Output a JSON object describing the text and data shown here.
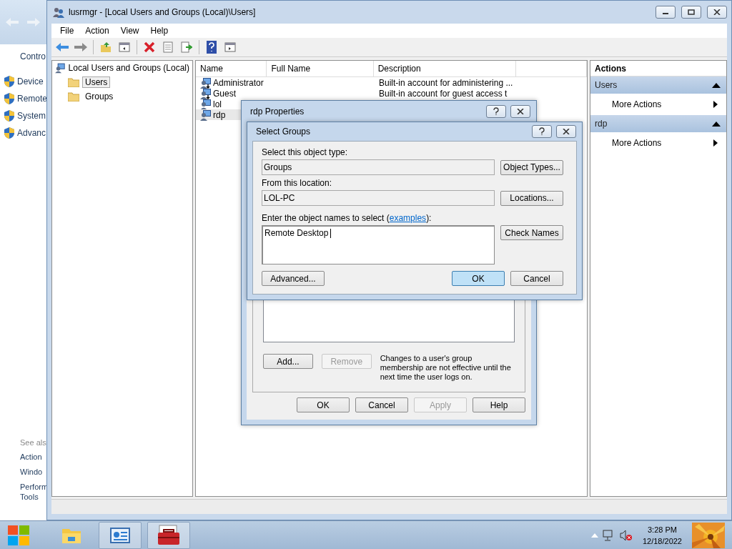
{
  "control_panel": {
    "header": "Contro",
    "items": [
      "Device",
      "Remote",
      "System",
      "Advanc"
    ],
    "see_also": {
      "heading": "See als",
      "items": [
        "Action",
        "Windo",
        "Perform Tools"
      ]
    }
  },
  "main_window": {
    "title": "lusrmgr - [Local Users and Groups (Local)\\Users]",
    "menu": [
      "File",
      "Action",
      "View",
      "Help"
    ],
    "tree": {
      "label": "Local Users and Groups (Local)",
      "children": [
        {
          "label": "Users",
          "selected": true
        },
        {
          "label": "Groups",
          "selected": false
        }
      ]
    },
    "list": {
      "columns": [
        "Name",
        "Full Name",
        "Description"
      ],
      "rows": [
        {
          "name": "Administrator",
          "kind": "builtin",
          "description": "Built-in account for administering ...",
          "selected": false
        },
        {
          "name": "Guest",
          "kind": "builtin",
          "description": "Built-in account for guest access t",
          "selected": false
        },
        {
          "name": "lol",
          "kind": "user",
          "selected": false
        },
        {
          "name": "rdp",
          "kind": "user",
          "selected": true
        }
      ]
    },
    "actions": {
      "title": "Actions",
      "sections": [
        {
          "label": "Users",
          "items": [
            "More Actions"
          ]
        },
        {
          "label": "rdp",
          "items": [
            "More Actions"
          ]
        }
      ]
    }
  },
  "properties_dialog": {
    "title": "rdp Properties",
    "member_buttons": [
      {
        "label": "Add...",
        "disabled": false
      },
      {
        "label": "Remove",
        "disabled": true
      }
    ],
    "note": "Changes to a user's group membership are not effective until the next time the user logs on.",
    "buttons": [
      {
        "label": "OK",
        "disabled": false
      },
      {
        "label": "Cancel",
        "disabled": false
      },
      {
        "label": "Apply",
        "disabled": true
      },
      {
        "label": "Help",
        "disabled": false
      }
    ]
  },
  "select_groups": {
    "title": "Select Groups",
    "object_type_label": "Select this object type:",
    "object_type": "Groups",
    "object_types_button": "Object Types...",
    "location_label": "From this location:",
    "location": "LOL-PC",
    "locations_button": "Locations...",
    "names_label_before": "Enter the object names to select (",
    "names_label_link": "examples",
    "names_label_after": "):",
    "names_value": "Remote Desktop",
    "check_names_button": "Check Names",
    "advanced_button": "Advanced...",
    "buttons": [
      {
        "label": "OK",
        "default": true
      },
      {
        "label": "Cancel",
        "default": false
      }
    ]
  },
  "taskbar": {
    "tasks": [
      {
        "kind": "explorer",
        "active": false
      },
      {
        "kind": "control",
        "active": true
      },
      {
        "kind": "toolbox",
        "active": true
      }
    ],
    "time": "3:28 PM",
    "date": "12/18/2022"
  }
}
